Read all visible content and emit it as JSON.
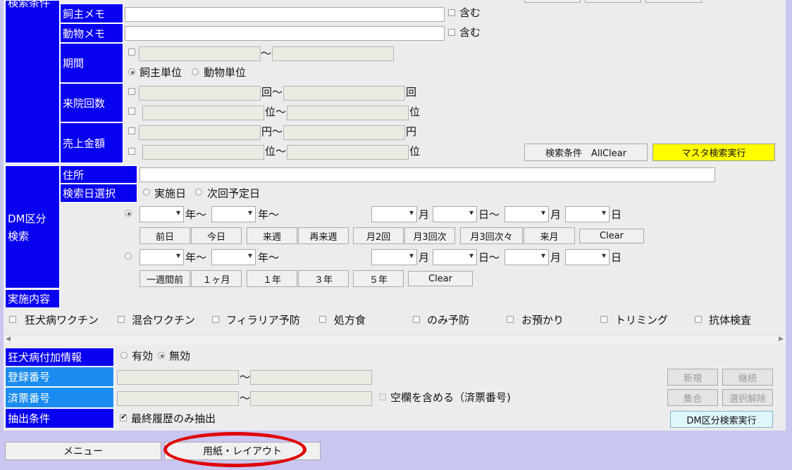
{
  "search": {
    "section_label": "検索条件",
    "owner_memo": {
      "label": "飼主メモ",
      "contains": "含む"
    },
    "animal_memo": {
      "label": "動物メモ",
      "contains": "含む"
    },
    "period": {
      "label": "期間",
      "tilde": "〜",
      "opt_owner": "飼主単位",
      "opt_animal": "動物単位"
    },
    "visits": {
      "label": "来院回数",
      "unit1": "回〜",
      "unit2": "回",
      "rank1": "位〜",
      "rank2": "位"
    },
    "sales": {
      "label": "売上金額",
      "unit1": "円〜",
      "unit2": "円",
      "rank1": "位〜",
      "rank2": "位"
    },
    "allclear_label": "検索条件　AllClear",
    "master_search_label": "マスタ検索実行"
  },
  "dm": {
    "section_label_1": "DM区分",
    "section_label_2": "検索",
    "address_label": "住所",
    "date_select_label": "検索日選択",
    "opt_done": "実施日",
    "opt_next": "次回予定日",
    "year_tilde": "年〜",
    "month": "月",
    "day_tilde": "日〜",
    "day": "日",
    "buttons1": [
      "前日",
      "今日",
      "来週",
      "再来週",
      "月2回",
      "月3回次",
      "月3回次々",
      "来月",
      "Clear"
    ],
    "buttons2": [
      "一週間前",
      "１ヶ月",
      "１年",
      "３年",
      "５年",
      "Clear"
    ]
  },
  "content": {
    "label": "実施内容",
    "items": [
      "狂犬病ワクチン",
      "混合ワクチン",
      "フィラリア予防",
      "処方食",
      "のみ予防",
      "お預かり",
      "トリミング",
      "抗体検査"
    ]
  },
  "rabies": {
    "label": "狂犬病付加情報",
    "opt_valid": "有効",
    "opt_invalid": "無効"
  },
  "reg_no": {
    "label": "登録番号",
    "tilde": "〜"
  },
  "tag_no": {
    "label": "済票番号",
    "tilde": "〜",
    "include_blank": "空欄を含める（済票番号)"
  },
  "extract": {
    "label": "抽出条件",
    "latest_only": "最終履歴のみ抽出"
  },
  "actions": {
    "new": "新規",
    "continue": "継続",
    "aggregate": "集合",
    "deselect": "選択解除",
    "dm_search": "DM区分検索実行"
  },
  "footer": {
    "menu": "メニュー",
    "paper_layout": "用紙・レイアウト"
  },
  "colors": {
    "header_blue": "#0a00f0",
    "light_blue": "#1a8cf0",
    "highlight_yellow": "#ffff00",
    "annotation_red": "#e00000"
  }
}
